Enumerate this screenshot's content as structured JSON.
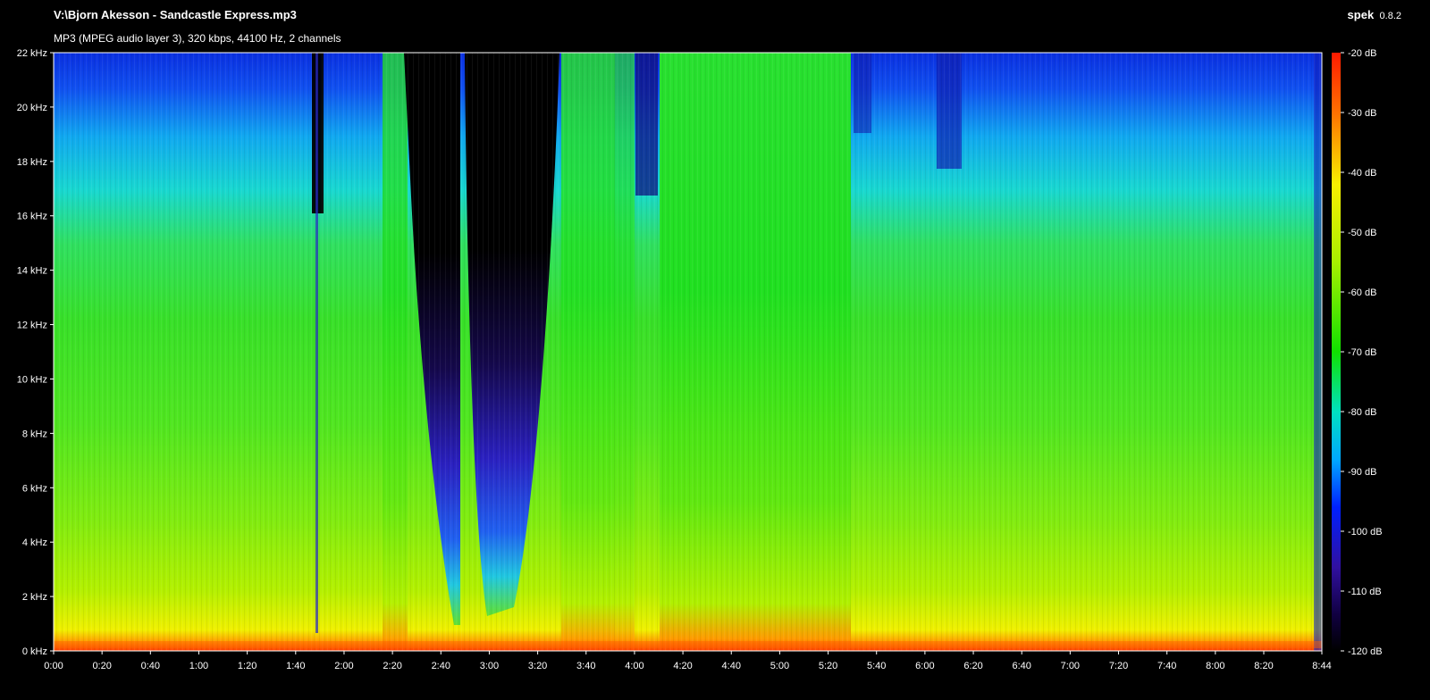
{
  "header": {
    "file_title": "V:\\Bjorn Akesson - Sandcastle Express.mp3",
    "file_info": "MP3 (MPEG audio layer 3), 320 kbps, 44100 Hz, 2 channels",
    "app_name": "spek",
    "app_version": "0.8.2"
  },
  "frequency_axis": {
    "ticks": [
      "22 kHz",
      "20 kHz",
      "18 kHz",
      "16 kHz",
      "14 kHz",
      "12 kHz",
      "10 kHz",
      "8 kHz",
      "6 kHz",
      "4 kHz",
      "2 kHz",
      "0 kHz"
    ],
    "range_khz": [
      0,
      22
    ]
  },
  "time_axis": {
    "ticks": [
      "0:00",
      "0:20",
      "0:40",
      "1:00",
      "1:20",
      "1:40",
      "2:00",
      "2:20",
      "2:40",
      "3:00",
      "3:20",
      "3:40",
      "4:00",
      "4:20",
      "4:40",
      "5:00",
      "5:20",
      "5:40",
      "6:00",
      "6:20",
      "6:40",
      "7:00",
      "7:20",
      "7:40",
      "8:00",
      "8:20",
      "8:44"
    ],
    "duration": "8:44"
  },
  "db_scale": {
    "ticks": [
      "-20 dB",
      "-30 dB",
      "-40 dB",
      "-50 dB",
      "-60 dB",
      "-70 dB",
      "-80 dB",
      "-90 dB",
      "-100 dB",
      "-110 dB",
      "-120 dB"
    ],
    "range_db": [
      -120,
      -20
    ]
  },
  "colors": {
    "background": "#000000",
    "scale_top": "#ff2000",
    "scale_mid": "#00e000",
    "scale_bottom": "#000000"
  }
}
